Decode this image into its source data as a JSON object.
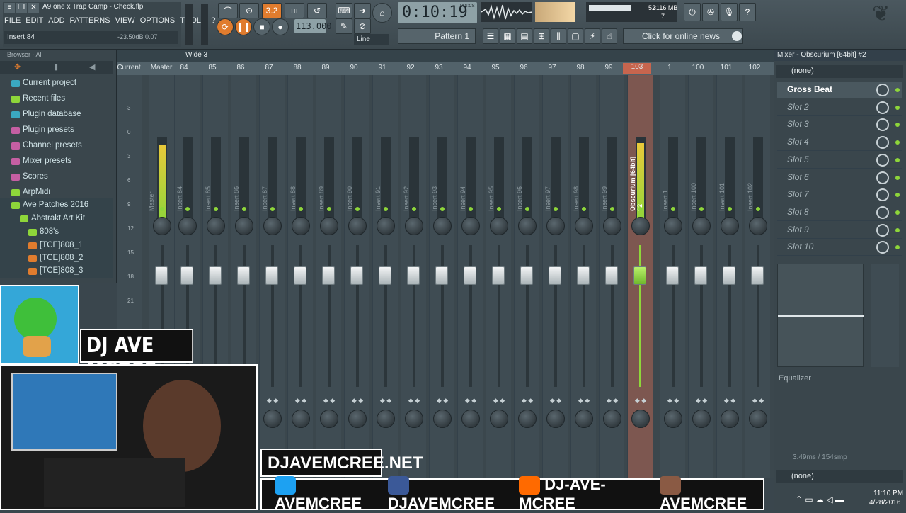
{
  "window": {
    "title": "A9 one x Trap Camp - Check.flp"
  },
  "menu": [
    "FILE",
    "EDIT",
    "ADD",
    "PATTERNS",
    "VIEW",
    "OPTIONS",
    "TOOLS",
    "?"
  ],
  "hint": {
    "text": "Insert 84",
    "values": "-23.50dB  0.07"
  },
  "transport": {
    "time": "0:10:19",
    "time_unit": "M:S:CS",
    "tempo": "113.000",
    "snap": "Line",
    "pattern": "Pattern 1"
  },
  "cpu": {
    "value": "52",
    "memory": "3116 MB",
    "polyphony": "7"
  },
  "news": {
    "label": "Click for online news"
  },
  "browser": {
    "title": "Browser - All",
    "items": [
      {
        "label": "Current project",
        "color": "#3aa8c1"
      },
      {
        "label": "Recent files",
        "color": "#8ed63a"
      },
      {
        "label": "Plugin database",
        "color": "#3aa8c1"
      },
      {
        "label": "Plugin presets",
        "color": "#c55fa3"
      },
      {
        "label": "Channel presets",
        "color": "#c55fa3"
      },
      {
        "label": "Mixer presets",
        "color": "#c55fa3"
      },
      {
        "label": "Scores",
        "color": "#c55fa3"
      },
      {
        "label": "ArpMidi",
        "color": "#8ed63a"
      },
      {
        "label": "Ave Patches 2016",
        "color": "#8ed63a"
      },
      {
        "label": "Abstrakt Art Kit",
        "color": "#8ed63a"
      },
      {
        "label": "808's",
        "color": "#8ed63a"
      },
      {
        "label": "[TCE]808_1",
        "color": "#e07c2e"
      },
      {
        "label": "[TCE]808_2",
        "color": "#e07c2e"
      },
      {
        "label": "[TCE]808_3",
        "color": "#e07c2e"
      }
    ]
  },
  "mixer": {
    "header": "Wide 3",
    "column_labels": [
      "Current",
      "Master",
      "84",
      "85",
      "86",
      "87",
      "88",
      "89",
      "90",
      "91",
      "92",
      "93",
      "94",
      "95",
      "96",
      "97",
      "98",
      "99",
      "103",
      "1",
      "100",
      "101",
      "102"
    ],
    "scale": [
      "3",
      "0",
      "3",
      "6",
      "9",
      "12",
      "15",
      "18",
      "21"
    ],
    "strip_names": [
      "Master",
      "Insert 84",
      "Insert 85",
      "Insert 86",
      "Insert 87",
      "Insert 88",
      "Insert 89",
      "Insert 90",
      "Insert 91",
      "Insert 92",
      "Insert 93",
      "Insert 94",
      "Insert 95",
      "Insert 96",
      "Insert 97",
      "Insert 98",
      "Insert 99",
      "Obscurium [64bit] #2",
      "Insert 1",
      "Insert 100",
      "Insert 101",
      "Insert 102"
    ]
  },
  "rpanel": {
    "title": "Mixer - Obscurium [64bit] #2",
    "input": "(none)",
    "output": "(none)",
    "eq": "Equalizer",
    "latency": "3.49ms / 154smp",
    "slots": [
      "Gross Beat",
      "Slot 2",
      "Slot 3",
      "Slot 4",
      "Slot 5",
      "Slot 6",
      "Slot 7",
      "Slot 8",
      "Slot 9",
      "Slot 10"
    ]
  },
  "overlay": {
    "dj": "DJ AVE MCREE",
    "site": "DJAVEMCREE.NET",
    "socials": [
      {
        "label": "AVEMCREE",
        "color": "#1da1f2"
      },
      {
        "label": "DJAVEMCREE",
        "color": "#3b5998"
      },
      {
        "label": "DJ-AVE-MCREE",
        "color": "#ff6a00"
      },
      {
        "label": "AVEMCREE",
        "color": "#8a5a44"
      }
    ]
  },
  "taskbar": {
    "time": "11:10 PM",
    "date": "4/28/2016"
  }
}
